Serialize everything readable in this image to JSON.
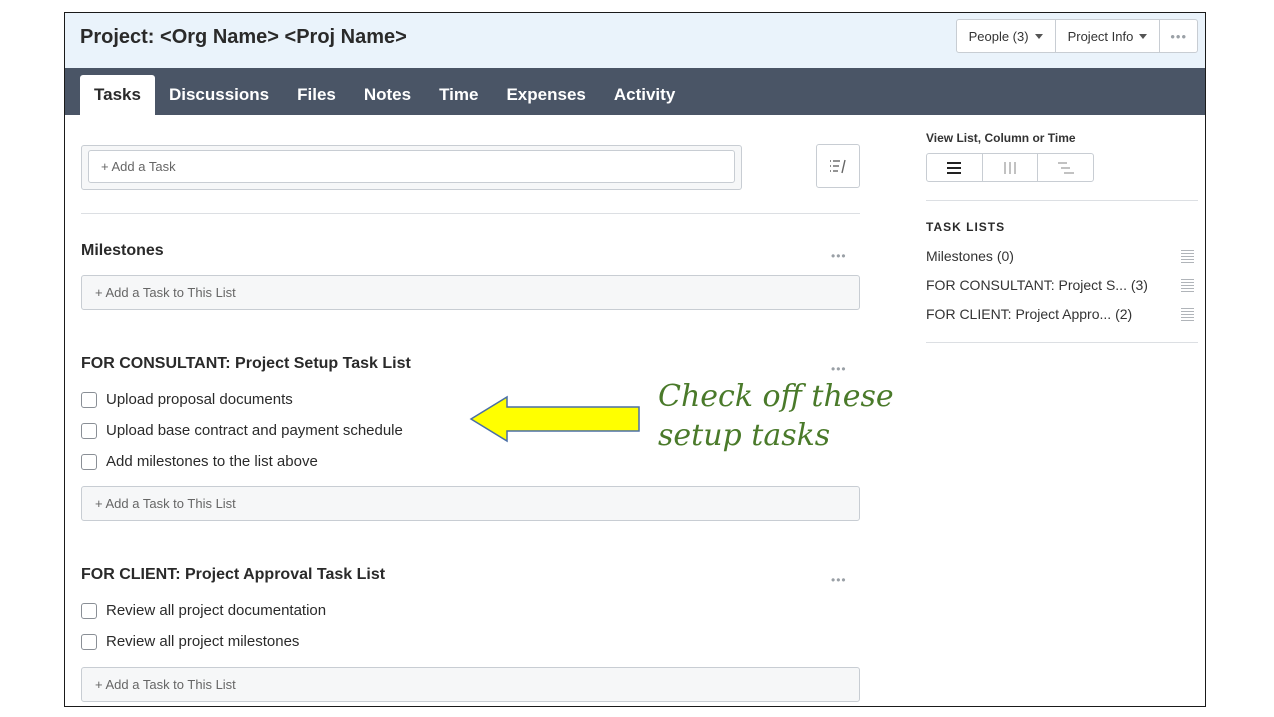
{
  "header": {
    "title": "Project: <Org Name> <Proj Name>",
    "people_label": "People (3)",
    "project_info_label": "Project Info",
    "more_label": "•••"
  },
  "tabs": [
    {
      "label": "Tasks",
      "active": true
    },
    {
      "label": "Discussions"
    },
    {
      "label": "Files"
    },
    {
      "label": "Notes"
    },
    {
      "label": "Time"
    },
    {
      "label": "Expenses"
    },
    {
      "label": "Activity"
    }
  ],
  "main": {
    "add_task_placeholder": "+ Add a Task",
    "lists": [
      {
        "title": "Milestones",
        "more": "•••",
        "tasks": [],
        "add_label": "+ Add a Task to This List"
      },
      {
        "title": "FOR CONSULTANT: Project Setup Task List",
        "more": "•••",
        "tasks": [
          "Upload proposal documents",
          "Upload base contract and payment schedule",
          "Add milestones to the list above"
        ],
        "add_label": "+ Add a Task to This List"
      },
      {
        "title": "FOR CLIENT: Project Approval Task List",
        "more": "•••",
        "tasks": [
          "Review all project documentation",
          "Review all project milestones"
        ],
        "add_label": "+ Add a Task to This List"
      }
    ]
  },
  "annotation": {
    "line1": "Check off these",
    "line2": "setup tasks",
    "arrow_color": "#ffff00"
  },
  "sidebar": {
    "view_label": "View List, Column or Time",
    "task_lists_heading": "TASK LISTS",
    "items": [
      {
        "name": "Milestones",
        "count": "(0)"
      },
      {
        "name": "FOR CONSULTANT: Project S...",
        "count": "(3)"
      },
      {
        "name": "FOR CLIENT: Project Appro...",
        "count": "(2)"
      }
    ]
  },
  "colors": {
    "header_bg": "#eaf3fb",
    "tabbar_bg": "#4a5566",
    "annotation_text": "#4a7a2a"
  }
}
